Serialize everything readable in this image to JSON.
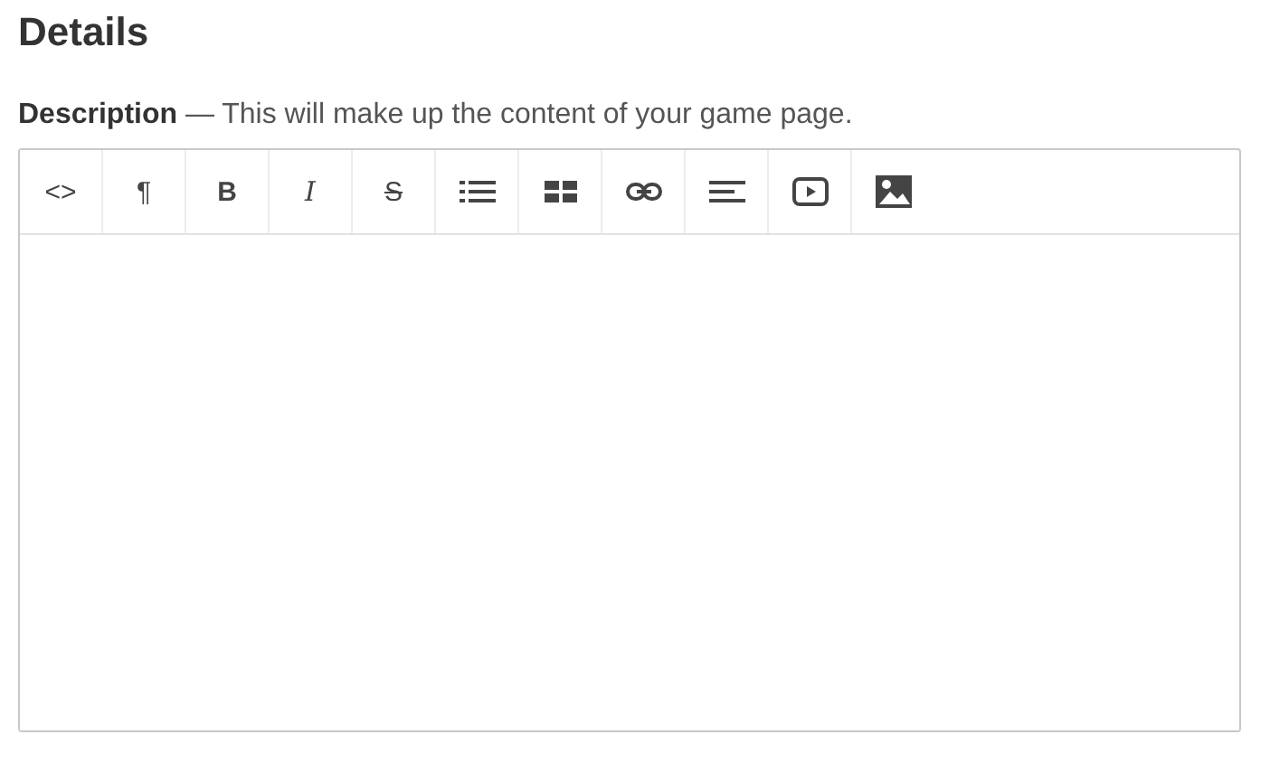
{
  "heading": "Details",
  "description": {
    "label": "Description",
    "text": "— This will make up the content of your game page."
  },
  "toolbar": [
    {
      "kind": "code",
      "label": "<>"
    },
    {
      "kind": "paragraph",
      "label": "¶"
    },
    {
      "kind": "bold",
      "label": "B"
    },
    {
      "kind": "italic",
      "label": "I"
    },
    {
      "kind": "strike",
      "label": "S"
    },
    {
      "kind": "list"
    },
    {
      "kind": "grid"
    },
    {
      "kind": "link"
    },
    {
      "kind": "align"
    },
    {
      "kind": "video"
    },
    {
      "kind": "image"
    }
  ]
}
